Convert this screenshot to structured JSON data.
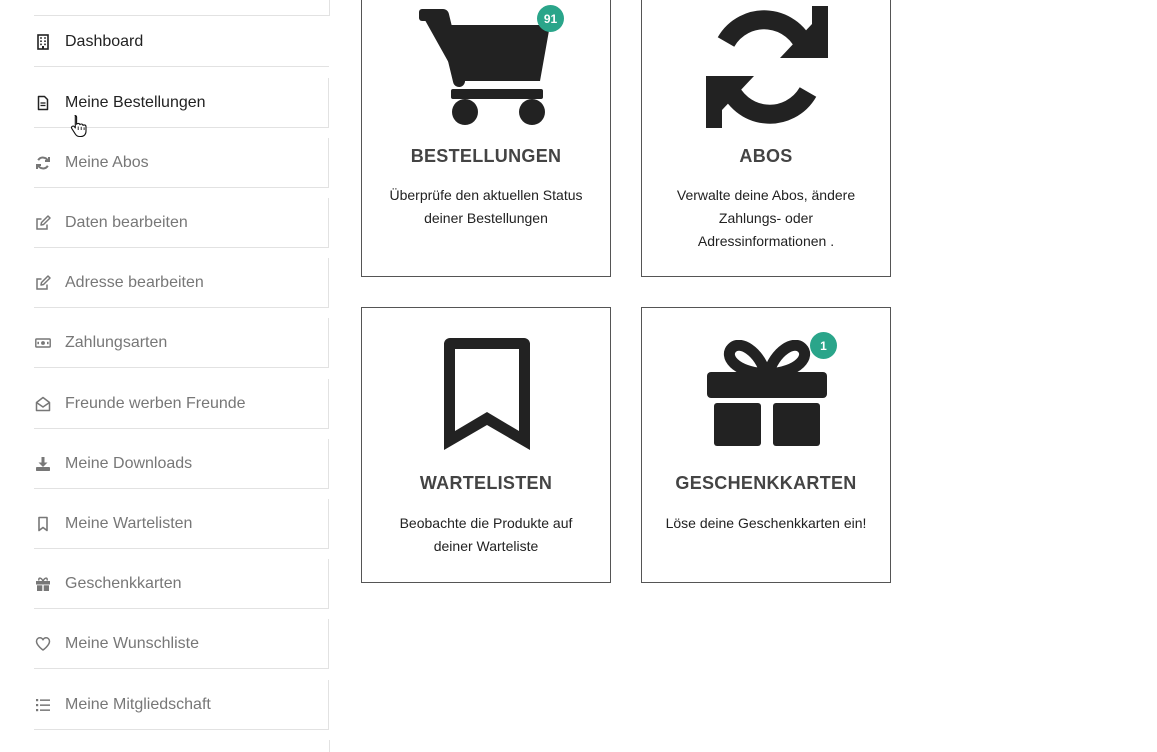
{
  "sidebar": {
    "items": [
      {
        "label": "Dashboard",
        "icon": "building-icon"
      },
      {
        "label": "Meine Bestellungen",
        "icon": "file-text-icon"
      },
      {
        "label": "Meine Abos",
        "icon": "sync-icon"
      },
      {
        "label": "Daten bearbeiten",
        "icon": "edit-icon"
      },
      {
        "label": "Adresse bearbeiten",
        "icon": "edit-icon"
      },
      {
        "label": "Zahlungsarten",
        "icon": "money-bill-icon"
      },
      {
        "label": "Freunde werben Freunde",
        "icon": "envelope-open-icon"
      },
      {
        "label": "Meine Downloads",
        "icon": "download-icon"
      },
      {
        "label": "Meine Wartelisten",
        "icon": "bookmark-icon"
      },
      {
        "label": "Geschenkkarten",
        "icon": "gift-icon"
      },
      {
        "label": "Meine Wunschliste",
        "icon": "heart-icon"
      },
      {
        "label": "Meine Mitgliedschaft",
        "icon": "list-icon"
      }
    ],
    "active_item": "Meine Bestellungen"
  },
  "cards": {
    "orders": {
      "title": "BESTELLUNGEN",
      "desc": "Überprüfe den aktuellen Status deiner Bestellungen",
      "badge": "91",
      "icon": "cart-icon"
    },
    "subs": {
      "title": "ABOS",
      "desc": "Verwalte deine Abos, ändere Zahlungs- oder Adressinformationen .",
      "icon": "sync-icon"
    },
    "waitlists": {
      "title": "WARTELISTEN",
      "desc": "Beobachte die Produkte auf deiner Warteliste",
      "icon": "bookmark-icon"
    },
    "giftcards": {
      "title": "GESCHENKKARTEN",
      "desc": "Löse deine Geschenkkarten ein!",
      "badge": "1",
      "icon": "gift-icon"
    }
  },
  "colors": {
    "badge": "#2aa58a",
    "icon": "#222222",
    "muted_text": "#777777"
  }
}
